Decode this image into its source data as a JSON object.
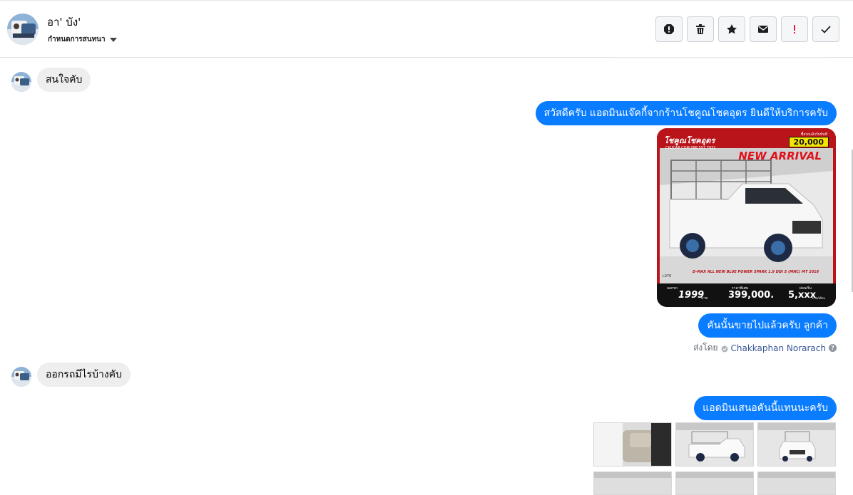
{
  "header": {
    "contact_name": "อา' บัง'",
    "assign_label": "กำหนดการสนทนา"
  },
  "toolbar": {
    "buttons": [
      {
        "name": "spam-icon"
      },
      {
        "name": "trash-icon"
      },
      {
        "name": "star-icon"
      },
      {
        "name": "envelope-icon"
      },
      {
        "name": "exclamation-icon"
      },
      {
        "name": "check-icon"
      }
    ]
  },
  "messages": [
    {
      "direction": "in",
      "text": "สนใจคับ"
    },
    {
      "direction": "out",
      "text": "สวัสดีครับ แอดมินแจ๊คกี้จากร้านโชคูณโชคอุดร ยินดีให้บริการครับ"
    },
    {
      "direction": "out",
      "text": "คันนั้นขายไปแล้วครับ ลูกค้า"
    },
    {
      "direction": "in",
      "text": "ออกรถมีไรบ้างคับ"
    },
    {
      "direction": "out",
      "text": "แอดมินเสนอคันนี้แทนนะครับ"
    }
  ],
  "sent_by": {
    "prefix": "ส่งโดย",
    "agent": "Chakkaphan Norarach"
  },
  "car_ad": {
    "brand": "โชคูณโชคอุดร",
    "phone": "CKUCAR.COM  088 557 7932",
    "down_label": "ซื้อรถแล้วรับทันที",
    "down_amount": "20,000",
    "badge": "NEW ARRIVAL",
    "model": "D-MAX ALL NEW BLUE POWER SPARK 1.9 DDI S (MNC) MT 2018",
    "code": "L076",
    "start_label": "ออกรถ",
    "start_amount": "1999",
    "start_unit": "บาท",
    "price_label": "ราคาพิเศษ",
    "price": "399,000.",
    "installment_label": "ผ่อนเริ่ม",
    "installment": "5,xxx",
    "installment_unit": "บาท/เดือน",
    "colors": {
      "bg": "#b8141a",
      "accent": "#f5e400",
      "text": "#ffffff"
    }
  },
  "colors": {
    "outgoing_bubble": "#0a7cff",
    "incoming_bubble": "#eeeeee",
    "link": "#385898"
  }
}
